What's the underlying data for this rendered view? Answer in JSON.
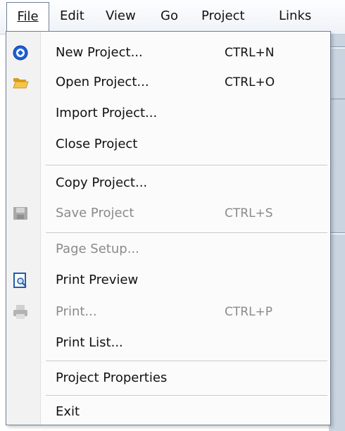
{
  "menubar": {
    "items": [
      {
        "label": "File"
      },
      {
        "label": "Edit"
      },
      {
        "label": "View"
      },
      {
        "label": "Go"
      },
      {
        "label": "Project"
      },
      {
        "label": "Links"
      }
    ]
  },
  "file_menu": {
    "items": [
      {
        "label": "New Project...",
        "shortcut": "CTRL+N",
        "icon": "new-project-icon",
        "enabled": true
      },
      {
        "label": "Open Project...",
        "shortcut": "CTRL+O",
        "icon": "folder-open-icon",
        "enabled": true
      },
      {
        "label": "Import Project...",
        "shortcut": "",
        "icon": "",
        "enabled": true
      },
      {
        "label": "Close Project",
        "shortcut": "",
        "icon": "",
        "enabled": true
      },
      {
        "label": "Copy Project...",
        "shortcut": "",
        "icon": "",
        "enabled": true
      },
      {
        "label": "Save Project",
        "shortcut": "CTRL+S",
        "icon": "save-icon",
        "enabled": false
      },
      {
        "label": "Page Setup...",
        "shortcut": "",
        "icon": "",
        "enabled": false
      },
      {
        "label": "Print Preview",
        "shortcut": "",
        "icon": "print-preview-icon",
        "enabled": true
      },
      {
        "label": "Print...",
        "shortcut": "CTRL+P",
        "icon": "printer-icon",
        "enabled": false
      },
      {
        "label": "Print List...",
        "shortcut": "",
        "icon": "",
        "enabled": true
      },
      {
        "label": "Project Properties",
        "shortcut": "",
        "icon": "",
        "enabled": true
      },
      {
        "label": "Exit",
        "shortcut": "",
        "icon": "",
        "enabled": true
      }
    ]
  },
  "colors": {
    "disabled_text": "#8a8a8a",
    "menu_border": "#6f7f93"
  }
}
